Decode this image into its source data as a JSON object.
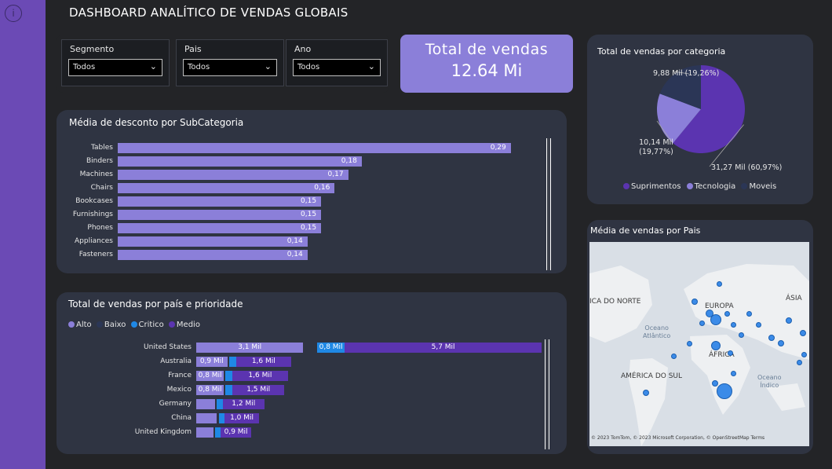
{
  "header": {
    "title": "DASHBOARD ANALÍTICO DE VENDAS GLOBAIS",
    "info_glyph": "i"
  },
  "slicers": [
    {
      "label": "Segmento",
      "value": "Todos"
    },
    {
      "label": "Pais",
      "value": "Todos"
    },
    {
      "label": "Ano",
      "value": "Todos"
    }
  ],
  "kpi": {
    "label": "Total de vendas",
    "value": "12.64 Mi"
  },
  "colors": {
    "alto": "#8b7fd9",
    "baixo": "#2f3442",
    "critico": "#1f88e5",
    "medio": "#5b34b0",
    "suprimentos": "#5b34b0",
    "tecnologia": "#8b7fd9",
    "moveis": "#2b3656"
  },
  "discount_chart": {
    "title": "Média de desconto por SubCategoria",
    "chart_data": {
      "type": "bar",
      "categories": [
        "Tables",
        "Binders",
        "Machines",
        "Chairs",
        "Bookcases",
        "Furnishings",
        "Phones",
        "Appliances",
        "Fasteners"
      ],
      "values": [
        0.29,
        0.18,
        0.17,
        0.16,
        0.15,
        0.15,
        0.15,
        0.14,
        0.14
      ],
      "labels": [
        "0,29",
        "0,18",
        "0,17",
        "0,16",
        "0,15",
        "0,15",
        "0,15",
        "0,14",
        "0,14"
      ],
      "xlim": [
        0,
        0.3
      ]
    }
  },
  "priority_chart": {
    "title": "Total de vendas por país e prioridade",
    "legend": [
      "Alto",
      "Baixo",
      "Critico",
      "Medio"
    ],
    "chart_data": {
      "type": "bar",
      "categories": [
        "United States",
        "Australia",
        "France",
        "Mexico",
        "Germany",
        "China",
        "United Kingdom"
      ],
      "series": [
        {
          "name": "Alto",
          "values": [
            3.1,
            0.9,
            0.8,
            0.8,
            0.55,
            0.6,
            0.5
          ],
          "labels": [
            "3,1 Mil",
            "0,9 Mil",
            "0,8 Mil",
            "0,8 Mil",
            "",
            "",
            ""
          ]
        },
        {
          "name": "Baixo",
          "values": [
            0.4,
            0.05,
            0.05,
            0.05,
            0.05,
            0.05,
            0.05
          ],
          "labels": [
            "",
            "",
            "",
            "",
            "",
            "",
            ""
          ]
        },
        {
          "name": "Critico",
          "values": [
            0.8,
            0.2,
            0.2,
            0.2,
            0.17,
            0.17,
            0.15
          ],
          "labels": [
            "0,8 Mil",
            "",
            "",
            "",
            "",
            "",
            ""
          ]
        },
        {
          "name": "Medio",
          "values": [
            5.7,
            1.6,
            1.6,
            1.5,
            1.2,
            1.0,
            0.9
          ],
          "labels": [
            "5,7 Mil",
            "1,6 Mil",
            "1,6 Mil",
            "1,5 Mil",
            "1,2 Mil",
            "1,0 Mil",
            "0,9 Mil"
          ]
        }
      ],
      "xlim": [
        0,
        10.0
      ]
    }
  },
  "pie_chart": {
    "title": "Total de vendas por categoria",
    "chart_data": {
      "type": "pie",
      "categories": [
        "Suprimentos",
        "Tecnologia",
        "Moveis"
      ],
      "values": [
        31.27,
        10.14,
        9.88
      ],
      "labels": [
        "31,27 Mil (60,97%)",
        "10,14 Mil (19,77%)",
        "9,88 Mil (19,26%)"
      ],
      "label_lines": [
        [
          "31,27 Mil (60,97%)"
        ],
        [
          "10,14 Mil",
          "(19,77%)"
        ],
        [
          "9,88 Mil (19,26%)"
        ]
      ]
    }
  },
  "map": {
    "title": "Média de vendas por Pais",
    "labels": [
      "ICA DO NORTE",
      "EUROPA",
      "ÁSIA",
      "ÁFRICA",
      "AMÉRICA DO SUL"
    ],
    "oceans": [
      [
        "Oceano",
        "Atlântico"
      ],
      [
        "Oceano",
        "Índico"
      ]
    ],
    "attribution": "© 2023 TomTom, © 2023 Microsoft Corporation, © OpenStreetMap  Terms"
  }
}
